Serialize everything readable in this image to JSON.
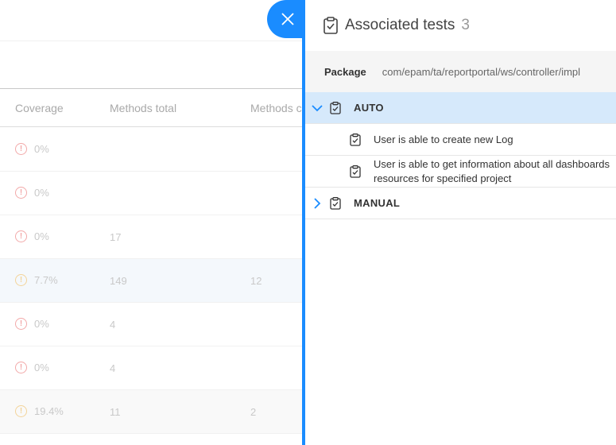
{
  "background_table": {
    "columns": {
      "coverage": "Coverage",
      "methods_total": "Methods total",
      "methods_covered": "Methods c"
    },
    "rows": [
      {
        "coverage": "0%",
        "methods_total": "",
        "methods_covered": "",
        "status": "red"
      },
      {
        "coverage": "0%",
        "methods_total": "",
        "methods_covered": "",
        "status": "red"
      },
      {
        "coverage": "0%",
        "methods_total": "17",
        "methods_covered": "",
        "status": "red"
      },
      {
        "coverage": "7.7%",
        "methods_total": "149",
        "methods_covered": "12",
        "status": "amber"
      },
      {
        "coverage": "0%",
        "methods_total": "4",
        "methods_covered": "",
        "status": "red"
      },
      {
        "coverage": "0%",
        "methods_total": "4",
        "methods_covered": "",
        "status": "red"
      },
      {
        "coverage": "19.4%",
        "methods_total": "11",
        "methods_covered": "2",
        "status": "amber"
      }
    ]
  },
  "panel": {
    "title": "Associated tests",
    "count": "3",
    "package_label": "Package",
    "package_value": "com/epam/ta/reportportal/ws/controller/impl",
    "groups": [
      {
        "label": "AUTO",
        "expanded": true,
        "tests": [
          {
            "line1": "User is able to create new Log",
            "line2": ""
          },
          {
            "line1": "User is able to get information about all dashboards",
            "line2": "resources for specified project"
          }
        ]
      },
      {
        "label": "MANUAL",
        "expanded": false,
        "tests": []
      }
    ]
  },
  "colors": {
    "accent": "#1a8cff",
    "active_row": "#d6e9fb",
    "package_bg": "#f5f5f5",
    "warn_red": "#f2a9a9",
    "warn_amber": "#f3d49a"
  },
  "icons": {
    "close": "close-icon",
    "clipboard": "clipboard-check-icon",
    "chevron_down": "chevron-down-icon",
    "chevron_right": "chevron-right-icon",
    "warning": "warning-circle-icon"
  }
}
